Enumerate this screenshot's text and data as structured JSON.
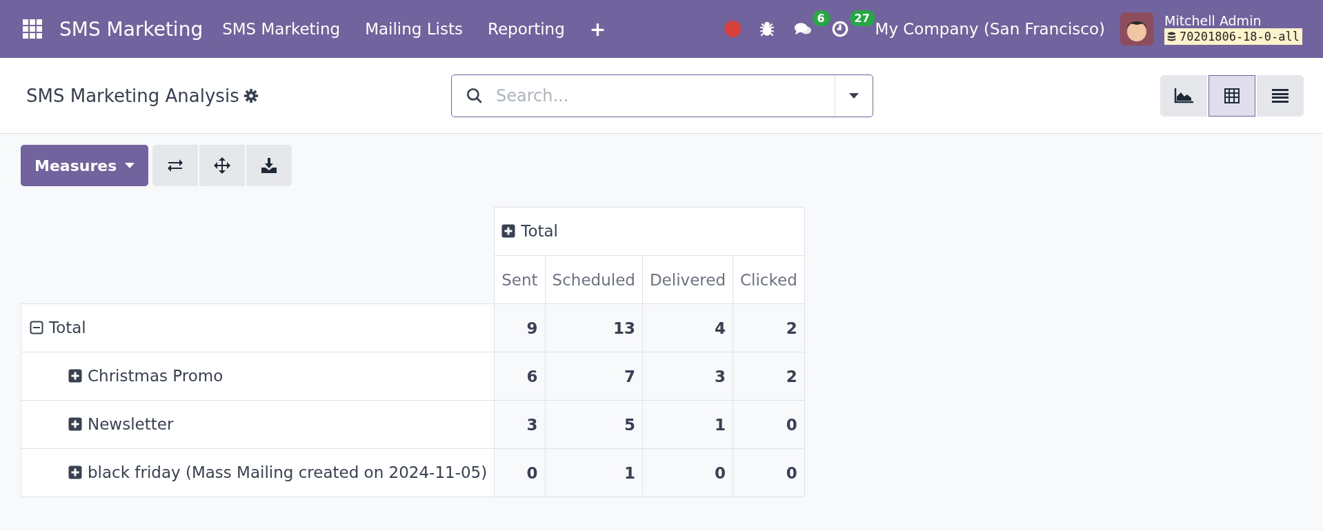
{
  "navbar": {
    "app_name": "SMS Marketing",
    "menu": [
      {
        "label": "SMS Marketing"
      },
      {
        "label": "Mailing Lists"
      },
      {
        "label": "Reporting"
      },
      {
        "label": "+"
      }
    ],
    "systray": [
      {
        "kind": "record"
      },
      {
        "kind": "debug"
      },
      {
        "kind": "messages",
        "badge": "6"
      },
      {
        "kind": "activities",
        "badge": "27"
      }
    ],
    "company": "My Company (San Francisco)",
    "user": {
      "name": "Mitchell Admin",
      "database": "70201806-18-0-all"
    }
  },
  "control_panel": {
    "title": "SMS Marketing Analysis",
    "search": {
      "placeholder": "Search..."
    },
    "views": [
      {
        "kind": "graph",
        "selected": false
      },
      {
        "kind": "pivot",
        "selected": true
      },
      {
        "kind": "list",
        "selected": false
      }
    ]
  },
  "toolbar": {
    "measures": "Measures",
    "actions": [
      {
        "kind": "flip"
      },
      {
        "kind": "expand"
      },
      {
        "kind": "download"
      }
    ]
  },
  "pivot": {
    "column_header": {
      "label": "Total",
      "expanded": false
    },
    "measures": [
      "Sent",
      "Scheduled",
      "Delivered",
      "Clicked"
    ],
    "rows": [
      {
        "label": "Total",
        "expanded": true,
        "values": [
          "9",
          "13",
          "4",
          "2"
        ],
        "children": [
          {
            "label": "Christmas Promo",
            "expanded": false,
            "values": [
              "6",
              "7",
              "3",
              "2"
            ]
          },
          {
            "label": "Newsletter",
            "expanded": false,
            "values": [
              "3",
              "5",
              "1",
              "0"
            ]
          },
          {
            "label": "black friday (Mass Mailing created on 2024-11-05)",
            "expanded": false,
            "values": [
              "0",
              "1",
              "0",
              "0"
            ]
          }
        ]
      }
    ]
  }
}
